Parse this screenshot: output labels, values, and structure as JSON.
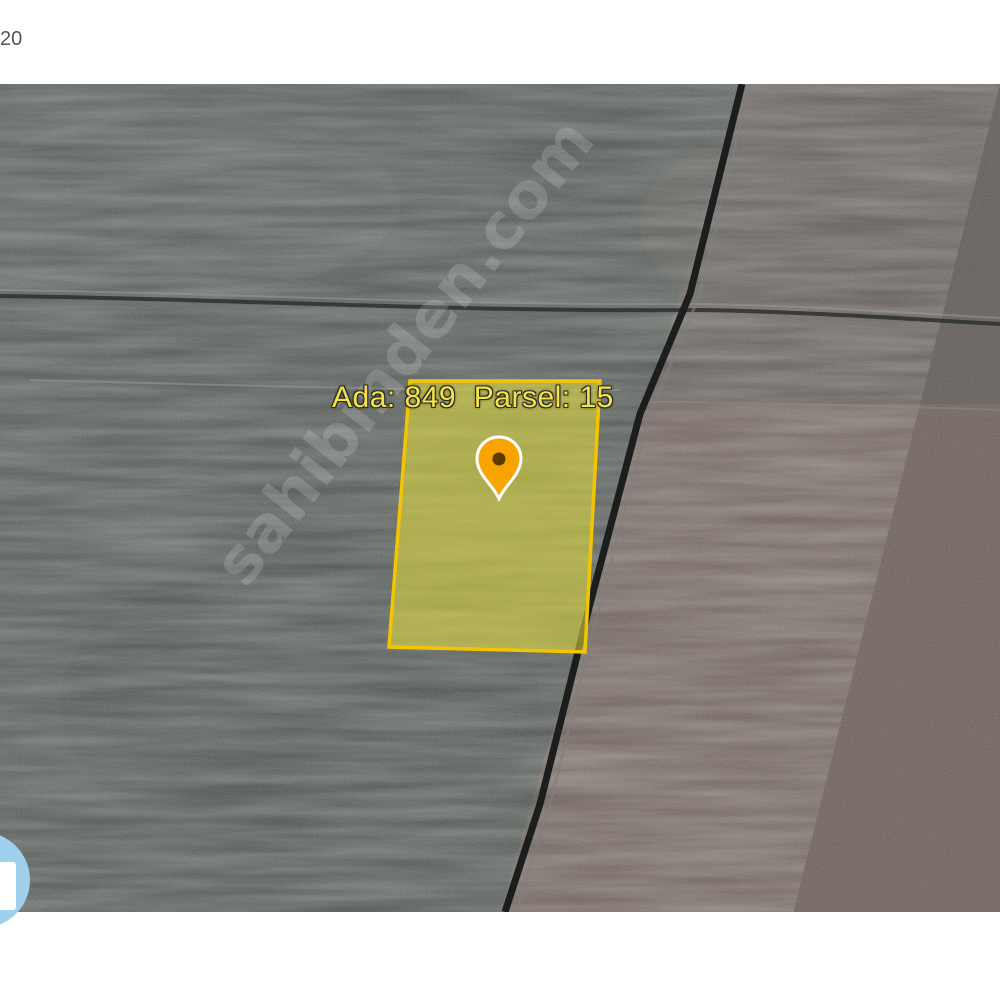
{
  "header": {
    "partial_text": "20"
  },
  "map": {
    "parcel": {
      "label": "Ada: 849  Parsel: 15",
      "fill_color": "#e3df3a",
      "border_color": "#f5c400"
    },
    "marker": {
      "icon": "map-pin-icon",
      "color": "#f7a300"
    },
    "watermark": "sahibinden.com"
  },
  "colors": {
    "label_text": "#f3e24a"
  }
}
